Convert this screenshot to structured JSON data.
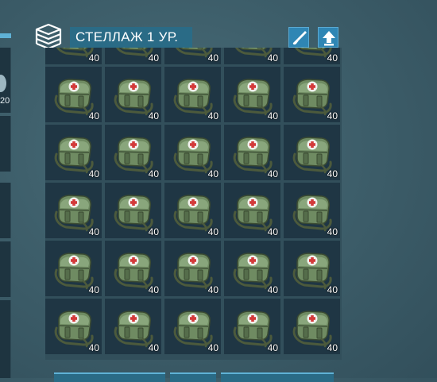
{
  "header": {
    "title": "СТЕЛЛАЖ 1 УР.",
    "icon": "storage-rack-icon",
    "buttons": [
      {
        "name": "skin-brush-button",
        "icon": "paint-brush-icon"
      },
      {
        "name": "upgrade-button",
        "icon": "arrow-up-icon"
      }
    ]
  },
  "left_panel": {
    "partial_value": "20"
  },
  "storage": {
    "item_icon": "medkit-bag-icon",
    "slots": [
      {
        "qty": "40"
      },
      {
        "qty": "40"
      },
      {
        "qty": "40"
      },
      {
        "qty": "40"
      },
      {
        "qty": "40"
      },
      {
        "qty": "40"
      },
      {
        "qty": "40"
      },
      {
        "qty": "40"
      },
      {
        "qty": "40"
      },
      {
        "qty": "40"
      },
      {
        "qty": "40"
      },
      {
        "qty": "40"
      },
      {
        "qty": "40"
      },
      {
        "qty": "40"
      },
      {
        "qty": "40"
      },
      {
        "qty": "40"
      },
      {
        "qty": "40"
      },
      {
        "qty": "40"
      },
      {
        "qty": "40"
      },
      {
        "qty": "40"
      },
      {
        "qty": "40"
      },
      {
        "qty": "40"
      },
      {
        "qty": "40"
      },
      {
        "qty": "40"
      },
      {
        "qty": "40"
      },
      {
        "qty": "40"
      },
      {
        "qty": "40"
      },
      {
        "qty": "40"
      },
      {
        "qty": "40"
      },
      {
        "qty": "40"
      }
    ]
  },
  "colors": {
    "background": "#3e5f6b",
    "slot": "#1f3644",
    "accent": "#2a6b86",
    "button": "#2f86b4"
  }
}
